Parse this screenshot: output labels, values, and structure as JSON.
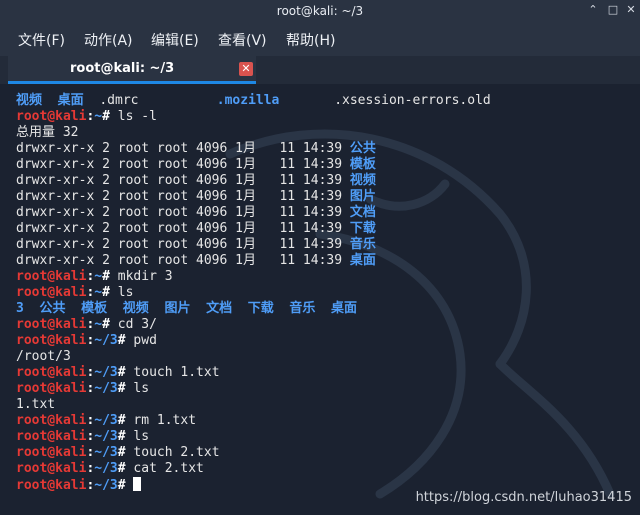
{
  "window": {
    "title": "root@kali: ~/3",
    "min_glyph": "⌃",
    "max_glyph": "□",
    "close_glyph": "✕"
  },
  "menu": [
    "文件(F)",
    "动作(A)",
    "编辑(E)",
    "查看(V)",
    "帮助(H)"
  ],
  "tab": {
    "label": "root@kali: ~/3",
    "close_glyph": "✕"
  },
  "prompt": {
    "user_host": "root@kali",
    "colon": ":",
    "cwd_home": "~",
    "cwd_3": "~/3",
    "symbol": "#"
  },
  "colors": {
    "prompt_red": "#e53935",
    "dir_blue": "#4f9df7",
    "accent": "#1e88e5",
    "tab_close": "#d9534f"
  },
  "terminal": {
    "home_listing": [
      "视频",
      "桌面",
      ".dmrc",
      ".mozilla",
      ".xsession-errors.old"
    ],
    "cmd_ls_l": "ls -l",
    "total": "总用量 32",
    "ls_rows": [
      {
        "meta": "drwxr-xr-x 2 root root 4096 1月   11 14:39",
        "name": "公共"
      },
      {
        "meta": "drwxr-xr-x 2 root root 4096 1月   11 14:39",
        "name": "模板"
      },
      {
        "meta": "drwxr-xr-x 2 root root 4096 1月   11 14:39",
        "name": "视频"
      },
      {
        "meta": "drwxr-xr-x 2 root root 4096 1月   11 14:39",
        "name": "图片"
      },
      {
        "meta": "drwxr-xr-x 2 root root 4096 1月   11 14:39",
        "name": "文档"
      },
      {
        "meta": "drwxr-xr-x 2 root root 4096 1月   11 14:39",
        "name": "下载"
      },
      {
        "meta": "drwxr-xr-x 2 root root 4096 1月   11 14:39",
        "name": "音乐"
      },
      {
        "meta": "drwxr-xr-x 2 root root 4096 1月   11 14:39",
        "name": "桌面"
      }
    ],
    "cmd_mkdir": "mkdir 3",
    "cmd_ls": "ls",
    "ls_listing": "3  公共  模板  视频  图片  文档  下载  音乐  桌面",
    "cmd_cd": "cd 3/",
    "cmd_pwd": "pwd",
    "pwd_output": "/root/3",
    "cmd_touch1": "touch 1.txt",
    "ls_file_output": "1.txt",
    "cmd_rm": "rm 1.txt",
    "cmd_touch2": "touch 2.txt",
    "cmd_cat": "cat 2.txt"
  },
  "watermark": "https://blog.csdn.net/luhao31415"
}
